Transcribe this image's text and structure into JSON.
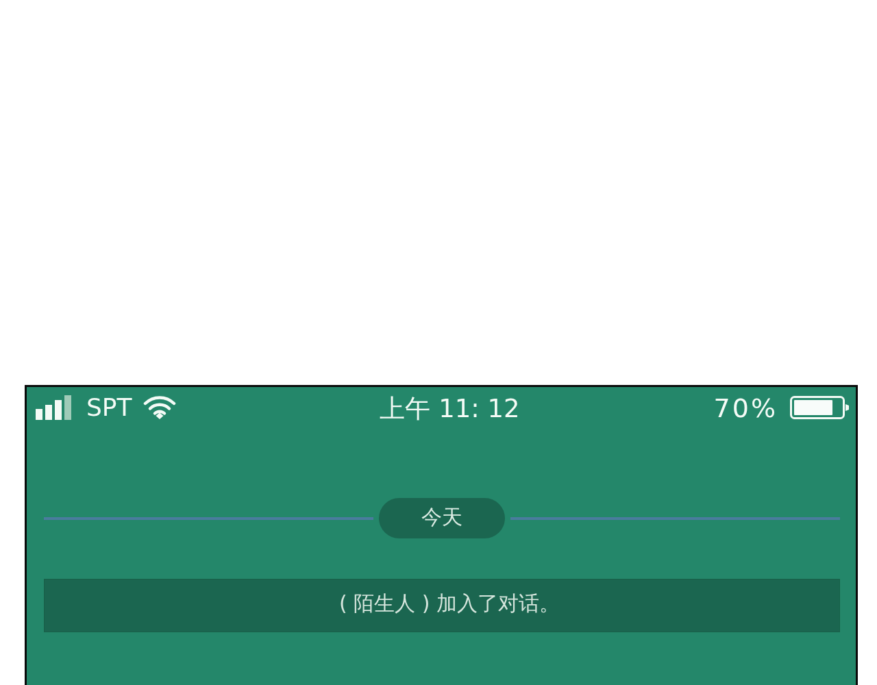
{
  "status_bar": {
    "carrier": "SPT",
    "time": "上午 11: 12",
    "battery": "70%"
  },
  "chat": {
    "date_divider": "今天",
    "system_message": "( 陌生人 ) 加入了对话。"
  }
}
